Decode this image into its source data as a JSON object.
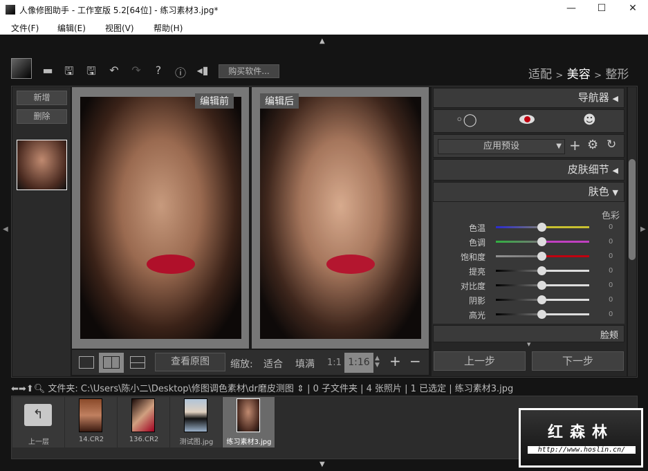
{
  "window": {
    "title": "人像修图助手 - 工作室版 5.2[64位] - 练习素材3.jpg*",
    "min": "—",
    "max": "☐",
    "close": "✕"
  },
  "menu": [
    "文件(F)",
    "编辑(E)",
    "视图(V)",
    "帮助(H)"
  ],
  "toolbar": {
    "buy_label": "购买软件...",
    "help": "?",
    "info": "ⓘ"
  },
  "workflow": {
    "step1": "适配",
    "sep": ">",
    "step2": "美容",
    "step3": "整形"
  },
  "left": {
    "add": "新增",
    "delete": "删除"
  },
  "preview": {
    "before": "编辑前",
    "after": "编辑后"
  },
  "viewbar": {
    "view_original": "查看原图",
    "zoom_label": "缩放:",
    "fit": "适合",
    "fill": "填满",
    "one_to_one": "1:1",
    "zoom_value": "1:16",
    "plus": "+",
    "minus": "−"
  },
  "right": {
    "navigator": "导航器",
    "preset": "应用预设",
    "skin_detail": "皮肤细节",
    "skin_color": "肤色",
    "color_group": "色彩",
    "sliders": [
      {
        "label": "色温",
        "value": "0",
        "left": "#2a2ad0",
        "right": "#c8c030"
      },
      {
        "label": "色调",
        "value": "0",
        "left": "#30b040",
        "right": "#c040c0"
      },
      {
        "label": "饱和度",
        "value": "0",
        "left": "#909090",
        "right": "#c00010"
      },
      {
        "label": "提亮",
        "value": "0",
        "left": "#000000",
        "right": "#dddddd"
      },
      {
        "label": "对比度",
        "value": "0",
        "left": "#000000",
        "right": "#dddddd"
      },
      {
        "label": "阴影",
        "value": "0",
        "left": "#000000",
        "right": "#dddddd"
      },
      {
        "label": "高光",
        "value": "0",
        "left": "#000000",
        "right": "#dddddd"
      }
    ],
    "cheek": "脸颊",
    "prev": "上一步",
    "next": "下一步"
  },
  "pathbar": {
    "folder_label": "文件夹:",
    "path": "C:\\Users\\陈小二\\Desktop\\修图调色素材\\dr磨皮测图",
    "info": "| 0 子文件夹 | 4 张照片 | 1 已选定 | 练习素材3.jpg"
  },
  "filmstrip": [
    {
      "label": "上一层"
    },
    {
      "label": "14.CR2"
    },
    {
      "label": "136.CR2"
    },
    {
      "label": "测试图.jpg"
    },
    {
      "label": "练习素材3.jpg",
      "selected": true
    }
  ],
  "watermark": {
    "name": "红森林",
    "url": "http://www.hoslin.cn/"
  }
}
